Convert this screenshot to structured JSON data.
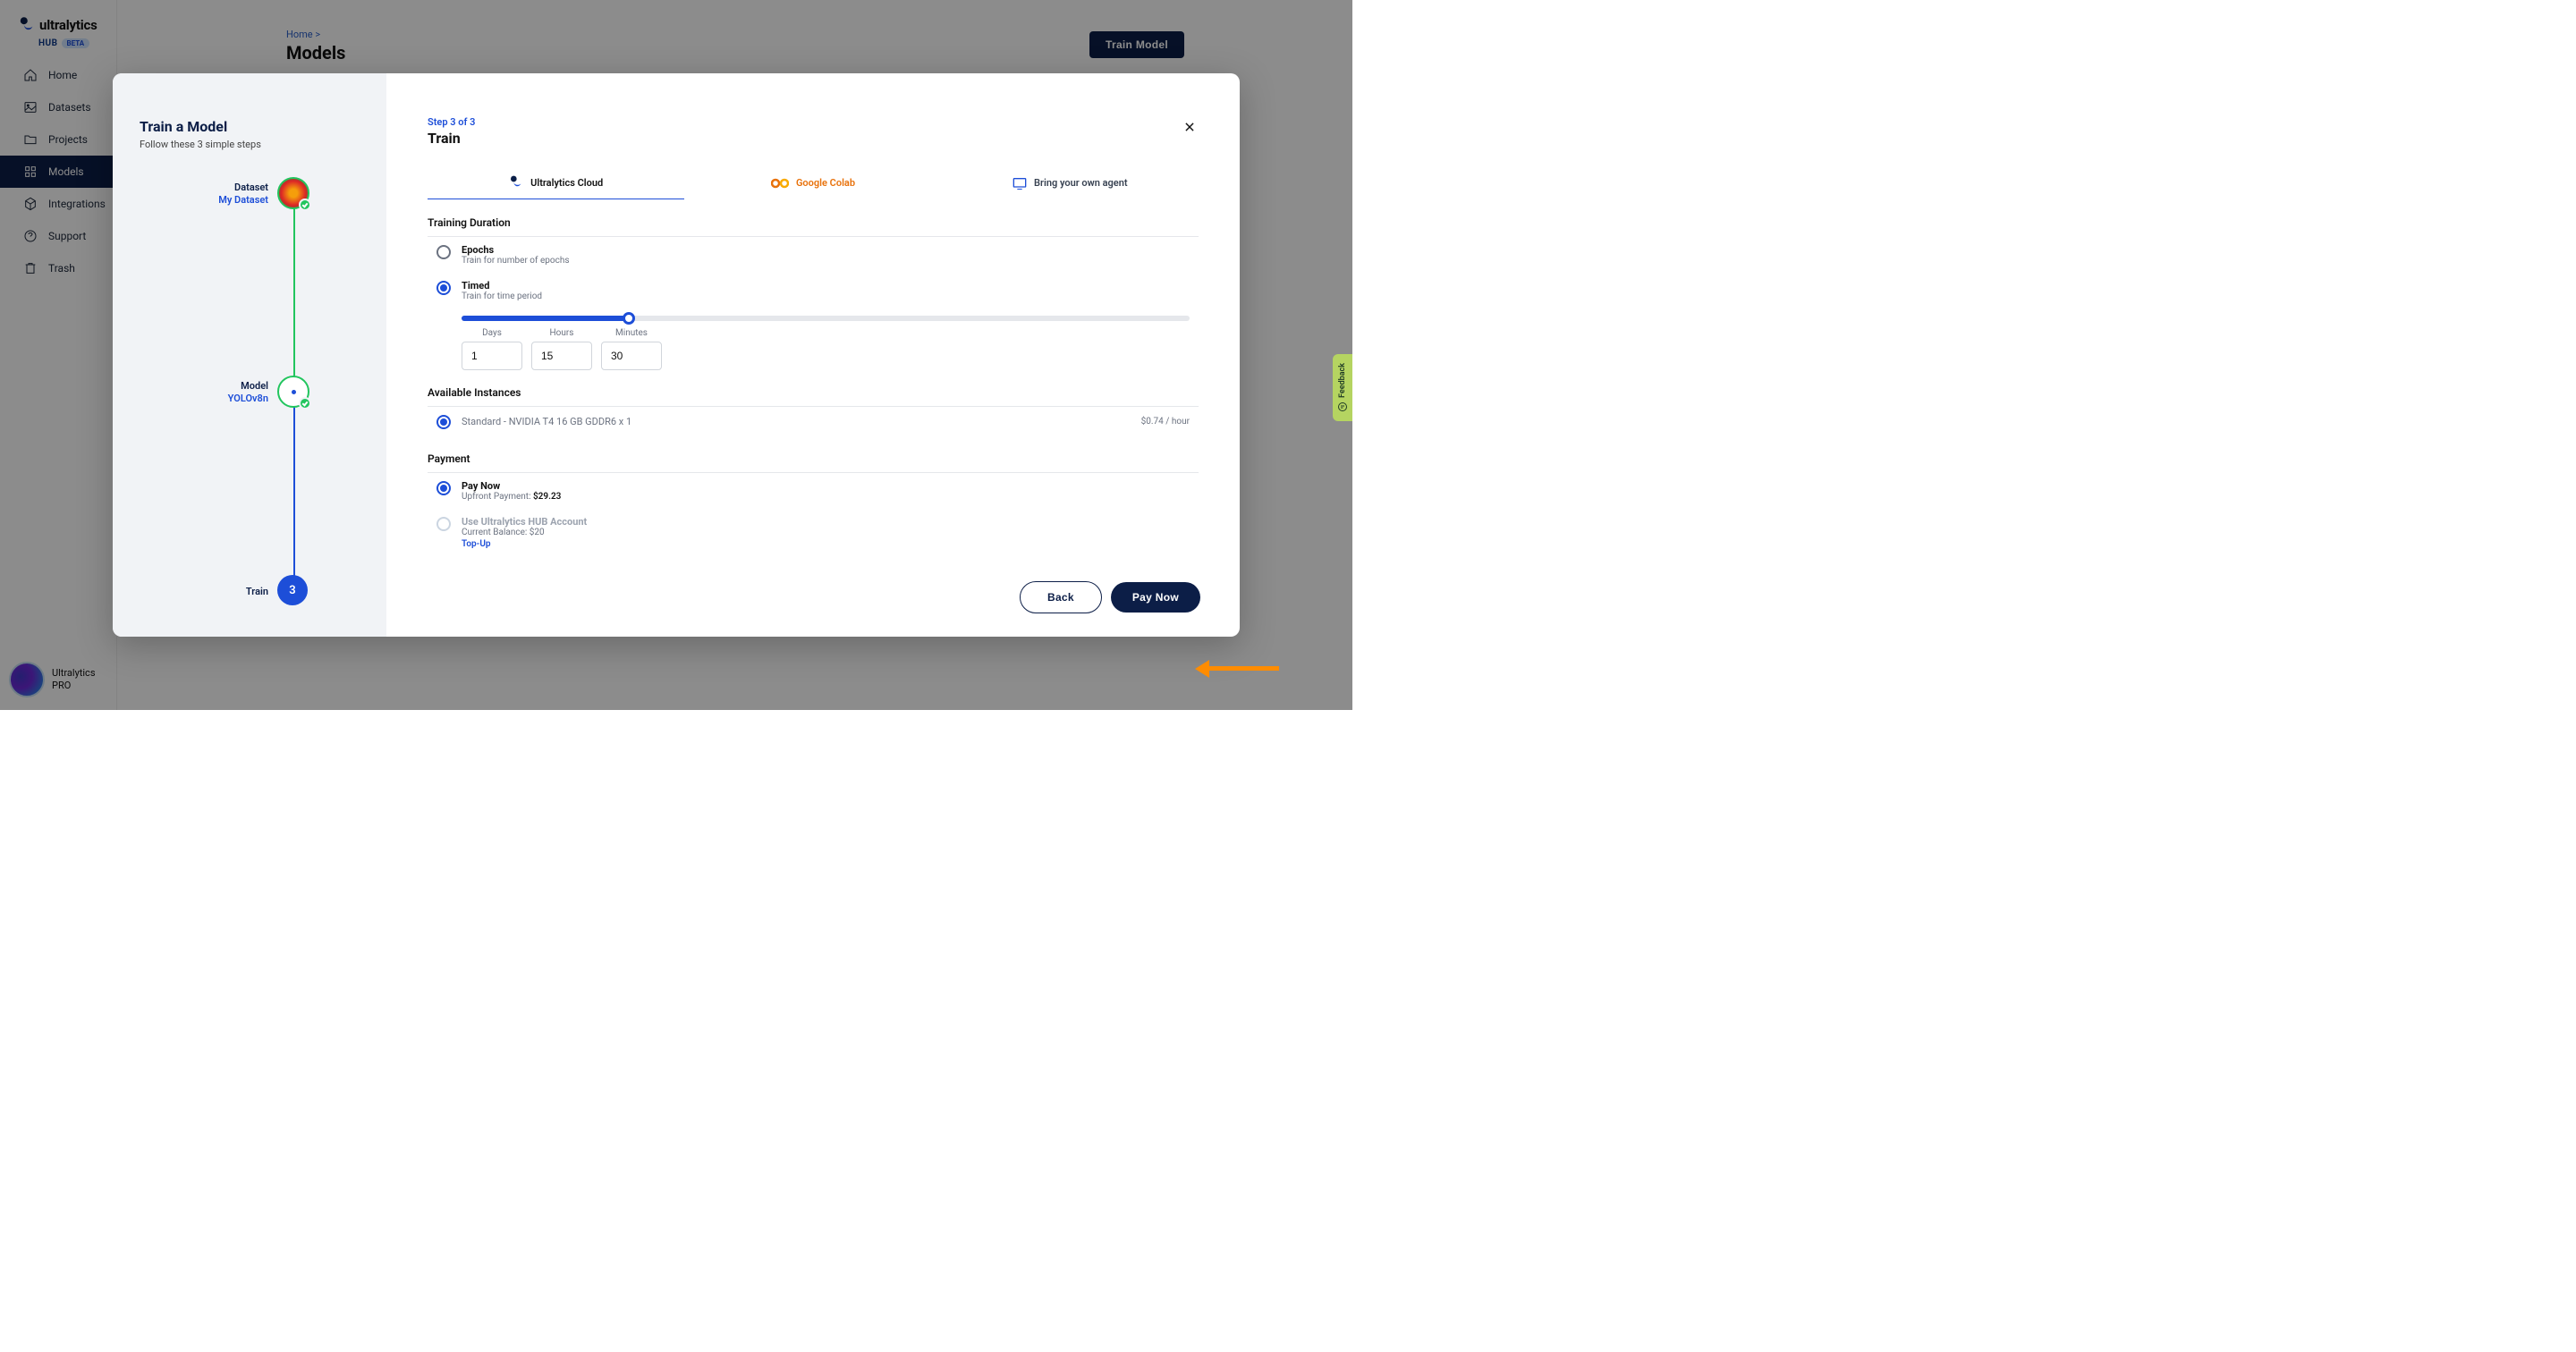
{
  "brand": {
    "name": "ultralytics",
    "hub": "HUB",
    "badge": "BETA"
  },
  "nav": {
    "home": "Home",
    "datasets": "Datasets",
    "projects": "Projects",
    "models": "Models",
    "integrations": "Integrations",
    "support": "Support",
    "trash": "Trash"
  },
  "sidebar_footer": {
    "line1": "Ultralytics",
    "line2": "PRO"
  },
  "breadcrumb": "Home  >",
  "page_title": "Models",
  "header_button": "Train Model",
  "modal_left": {
    "title": "Train a Model",
    "subtitle": "Follow these 3 simple steps",
    "step1_label": "Dataset",
    "step1_value": "My Dataset",
    "step2_label": "Model",
    "step2_value": "YOLOv8n",
    "step3_label": "Train",
    "step3_num": "3"
  },
  "modal_right": {
    "step_indicator": "Step 3 of 3",
    "title": "Train",
    "tabs": {
      "cloud": "Ultralytics Cloud",
      "colab": "Google Colab",
      "agent": "Bring your own agent"
    },
    "section_duration": "Training Duration",
    "epochs_title": "Epochs",
    "epochs_sub": "Train for number of epochs",
    "timed_title": "Timed",
    "timed_sub": "Train for time period",
    "days_label": "Days",
    "hours_label": "Hours",
    "minutes_label": "Minutes",
    "days_val": "1",
    "hours_val": "15",
    "minutes_val": "30",
    "section_instances": "Available Instances",
    "instance_name": "Standard - NVIDIA T4 16 GB GDDR6 x 1",
    "instance_price": "$0.74 / hour",
    "section_payment": "Payment",
    "paynow_title": "Pay Now",
    "paynow_sub_prefix": "Upfront Payment: ",
    "paynow_amount": "$29.23",
    "balance_title": "Use Ultralytics HUB Account",
    "balance_sub_prefix": "Current Balance: ",
    "balance_amount": "$20",
    "topup": "Top-Up",
    "back_btn": "Back",
    "pay_btn": "Pay Now"
  },
  "feedback": "Feedback"
}
